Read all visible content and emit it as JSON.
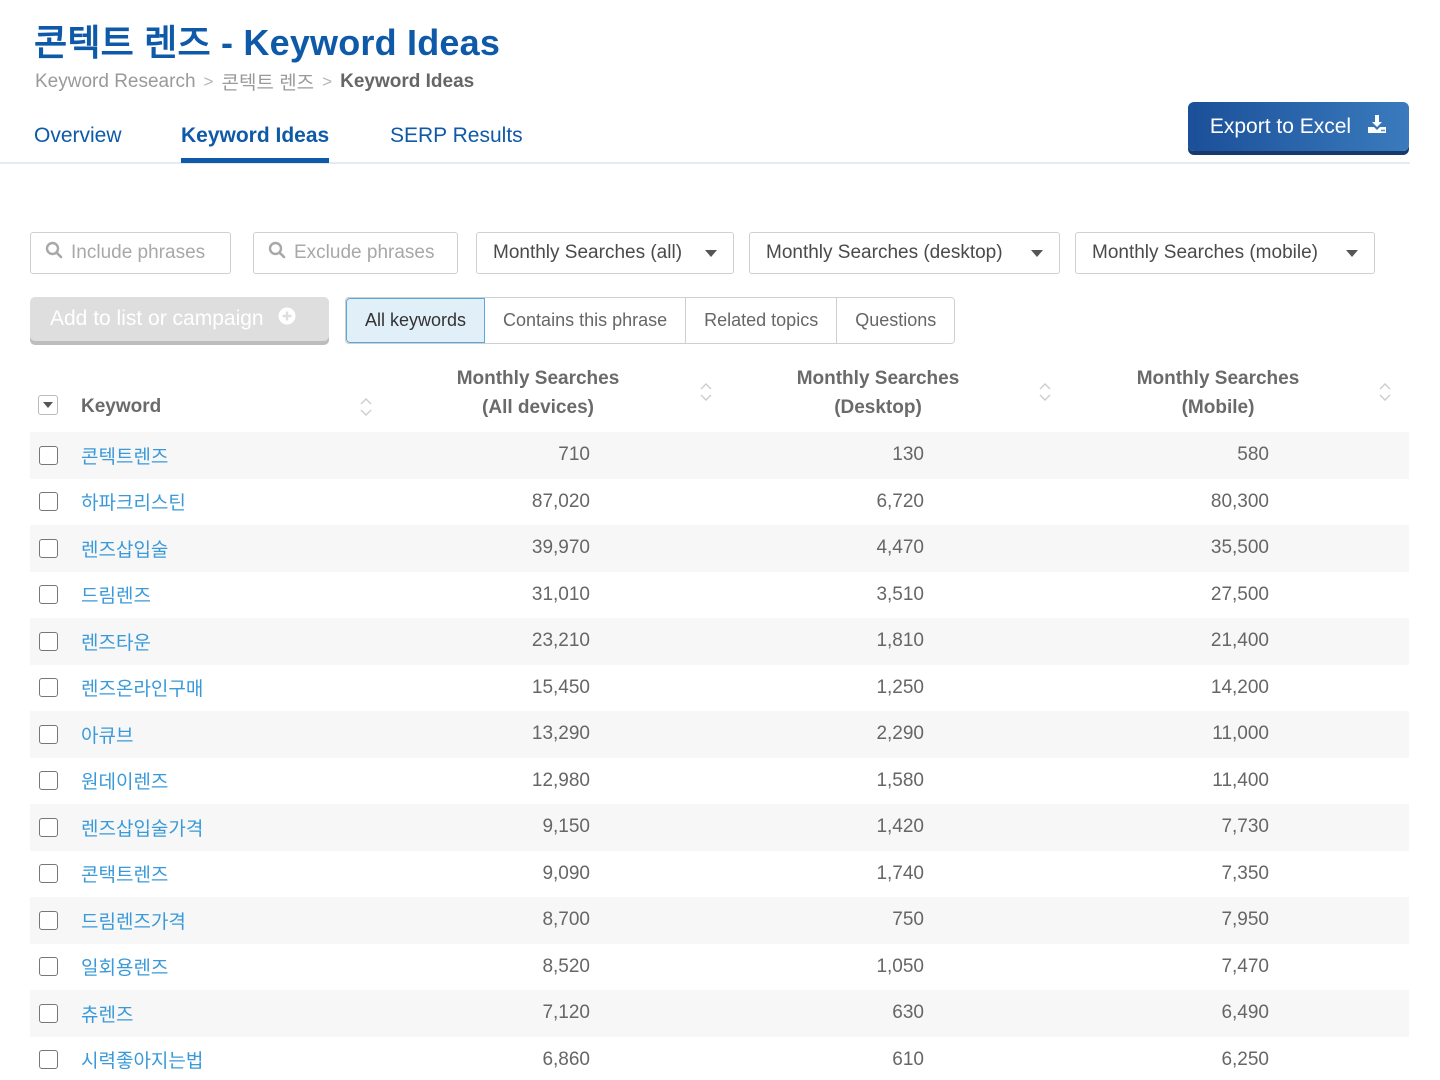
{
  "page": {
    "title": "콘텍트 렌즈 - Keyword Ideas",
    "breadcrumb": [
      "Keyword Research",
      "콘텍트 렌즈",
      "Keyword Ideas"
    ],
    "breadcrumb_separator": ">"
  },
  "tabs": [
    {
      "label": "Overview",
      "active": false
    },
    {
      "label": "Keyword Ideas",
      "active": true
    },
    {
      "label": "SERP Results",
      "active": false
    }
  ],
  "export_button": {
    "label": "Export to Excel",
    "icon": "download-icon"
  },
  "filters": {
    "include_placeholder": "Include phrases",
    "exclude_placeholder": "Exclude phrases",
    "selects": [
      {
        "label": "Monthly Searches (all)"
      },
      {
        "label": "Monthly Searches (desktop)"
      },
      {
        "label": "Monthly Searches (mobile)"
      }
    ]
  },
  "add_button": {
    "label": "Add to list or campaign",
    "icon": "plus-circle-icon",
    "disabled": true
  },
  "segments": [
    {
      "label": "All keywords",
      "active": true
    },
    {
      "label": "Contains this phrase",
      "active": false
    },
    {
      "label": "Related topics",
      "active": false
    },
    {
      "label": "Questions",
      "active": false
    }
  ],
  "table": {
    "columns": [
      {
        "label": "Keyword"
      },
      {
        "label_line1": "Monthly Searches",
        "label_line2": "(All devices)"
      },
      {
        "label_line1": "Monthly Searches",
        "label_line2": "(Desktop)"
      },
      {
        "label_line1": "Monthly Searches",
        "label_line2": "(Mobile)"
      }
    ],
    "rows": [
      {
        "keyword": "콘텍트렌즈",
        "all": "710",
        "desktop": "130",
        "mobile": "580"
      },
      {
        "keyword": "하파크리스틴",
        "all": "87,020",
        "desktop": "6,720",
        "mobile": "80,300"
      },
      {
        "keyword": "렌즈삽입술",
        "all": "39,970",
        "desktop": "4,470",
        "mobile": "35,500"
      },
      {
        "keyword": "드림렌즈",
        "all": "31,010",
        "desktop": "3,510",
        "mobile": "27,500"
      },
      {
        "keyword": "렌즈타운",
        "all": "23,210",
        "desktop": "1,810",
        "mobile": "21,400"
      },
      {
        "keyword": "렌즈온라인구매",
        "all": "15,450",
        "desktop": "1,250",
        "mobile": "14,200"
      },
      {
        "keyword": "아큐브",
        "all": "13,290",
        "desktop": "2,290",
        "mobile": "11,000"
      },
      {
        "keyword": "원데이렌즈",
        "all": "12,980",
        "desktop": "1,580",
        "mobile": "11,400"
      },
      {
        "keyword": "렌즈삽입술가격",
        "all": "9,150",
        "desktop": "1,420",
        "mobile": "7,730"
      },
      {
        "keyword": "콘택트렌즈",
        "all": "9,090",
        "desktop": "1,740",
        "mobile": "7,350"
      },
      {
        "keyword": "드림렌즈가격",
        "all": "8,700",
        "desktop": "750",
        "mobile": "7,950"
      },
      {
        "keyword": "일회용렌즈",
        "all": "8,520",
        "desktop": "1,050",
        "mobile": "7,470"
      },
      {
        "keyword": "츄렌즈",
        "all": "7,120",
        "desktop": "630",
        "mobile": "6,490"
      },
      {
        "keyword": "시력좋아지는법",
        "all": "6,860",
        "desktop": "610",
        "mobile": "6,250"
      }
    ]
  },
  "colors": {
    "brand_blue": "#0f5aa8",
    "link_blue": "#3a9ad9",
    "active_segment_bg": "#e1eff9"
  }
}
